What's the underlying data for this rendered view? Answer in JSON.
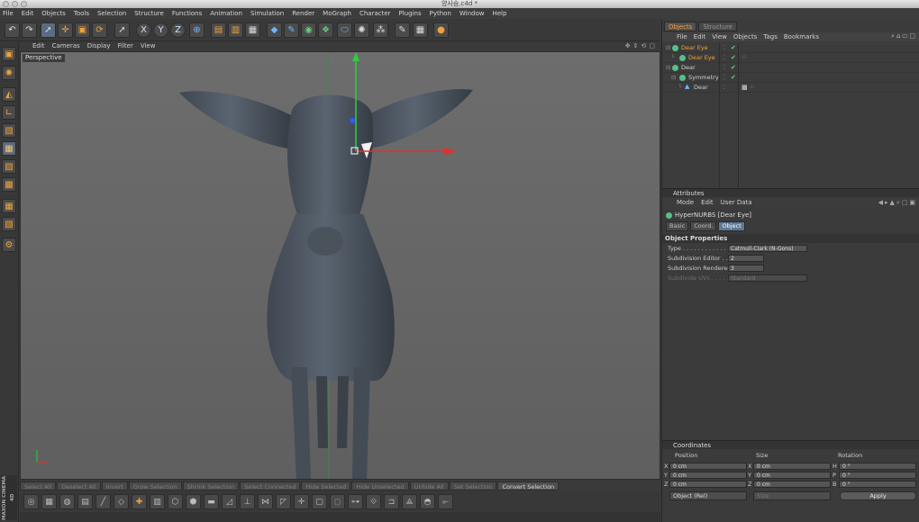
{
  "window": {
    "title": "양사슴.c4d *"
  },
  "menubar": [
    "File",
    "Edit",
    "Objects",
    "Tools",
    "Selection",
    "Structure",
    "Functions",
    "Animation",
    "Simulation",
    "Render",
    "MoGraph",
    "Character",
    "Plugins",
    "Python",
    "Window",
    "Help"
  ],
  "toolbar": {
    "icons": [
      "undo-icon",
      "redo-icon",
      "live-selection-icon",
      "move-icon",
      "scale-icon",
      "rotate-icon",
      "last-tool-icon",
      "x-axis-lock-icon",
      "y-axis-lock-icon",
      "z-axis-lock-icon",
      "coordinate-system-icon",
      "render-view-icon",
      "render-picture-viewer-icon",
      "render-settings-icon",
      "cube-icon",
      "pen-spline-icon",
      "subdivision-surface-icon",
      "array-icon",
      "deformer-icon",
      "scene-icon",
      "environment-icon",
      "camera-icon",
      "light-icon"
    ],
    "axis_labels": [
      "X",
      "Y",
      "Z"
    ]
  },
  "left_tools": [
    "make-editable-icon",
    "texture-icon",
    "workplane-icon",
    "points-mode-icon",
    "edges-mode-icon",
    "polygons-mode-icon",
    "model-mode-icon",
    "animation-mode-icon",
    "uv-mode-icon",
    "solo-icon",
    "snapping-icon"
  ],
  "branding": {
    "text": "MAXON CINEMA 4D"
  },
  "viewport": {
    "menu": [
      "Edit",
      "Cameras",
      "Display",
      "Filter",
      "View"
    ],
    "label": "Perspective"
  },
  "selection_bar": [
    "Select All",
    "Deselect All",
    "Invert",
    "Grow Selection",
    "Shrink Selection",
    "Select Connected",
    "Hide Selected",
    "Hide Unselected",
    "Unhide All",
    "Set Selection",
    "Convert Selection"
  ],
  "selection_bar_active": "Convert Selection",
  "objects_panel": {
    "tabs": [
      "Objects",
      "Structure"
    ],
    "active_tab": "Objects",
    "menu": [
      "File",
      "Edit",
      "View",
      "Objects",
      "Tags",
      "Bookmarks"
    ],
    "rows": [
      {
        "name": "Dear Eye",
        "depth": 0,
        "highlight": true,
        "tags": true
      },
      {
        "name": "Dear Eye",
        "depth": 1,
        "highlight": true,
        "tags": true
      },
      {
        "name": "Dear",
        "depth": 0,
        "highlight": false,
        "tags": false
      },
      {
        "name": "Symmetry",
        "depth": 1,
        "highlight": false,
        "tags": false
      },
      {
        "name": "Dear",
        "depth": 2,
        "highlight": false,
        "tags": true
      }
    ]
  },
  "attributes": {
    "title": "Attributes",
    "menu": [
      "Mode",
      "Edit",
      "User Data"
    ],
    "object_name": "HyperNURBS [Dear Eye]",
    "tabs": [
      "Basic",
      "Coord.",
      "Object"
    ],
    "active_tab": "Object",
    "section": "Object Properties",
    "props": [
      {
        "label": "Type . . . . . . . . . . . . .",
        "value": "Catmull-Clark (N-Gons)",
        "enabled": true
      },
      {
        "label": "Subdivision Editor . . .",
        "value": "2",
        "enabled": true
      },
      {
        "label": "Subdivision Renderer",
        "value": "3",
        "enabled": true
      },
      {
        "label": "Subdivide UVs . . . . . . .",
        "value": "Standard",
        "enabled": false
      }
    ]
  },
  "coordinates": {
    "title": "Coordinates",
    "columns": [
      "Position",
      "Size",
      "Rotation"
    ],
    "rows": [
      {
        "axis": "X",
        "pos": "0 cm",
        "size_axis": "X",
        "size": "0 cm",
        "rot_axis": "H",
        "rot": "0 °"
      },
      {
        "axis": "Y",
        "pos": "0 cm",
        "size_axis": "Y",
        "size": "0 cm",
        "rot_axis": "P",
        "rot": "0 °"
      },
      {
        "axis": "Z",
        "pos": "0 cm",
        "size_axis": "Z",
        "size": "0 cm",
        "rot_axis": "B",
        "rot": "0 °"
      }
    ],
    "mode": "Object (Rel)",
    "size_mode": "Size",
    "apply": "Apply"
  },
  "colors": {
    "accent": "#f0a23a",
    "selection_blue": "#5f7895",
    "axis_x": "#e03030",
    "axis_y": "#2ecc40",
    "axis_z": "#2a5cff"
  }
}
